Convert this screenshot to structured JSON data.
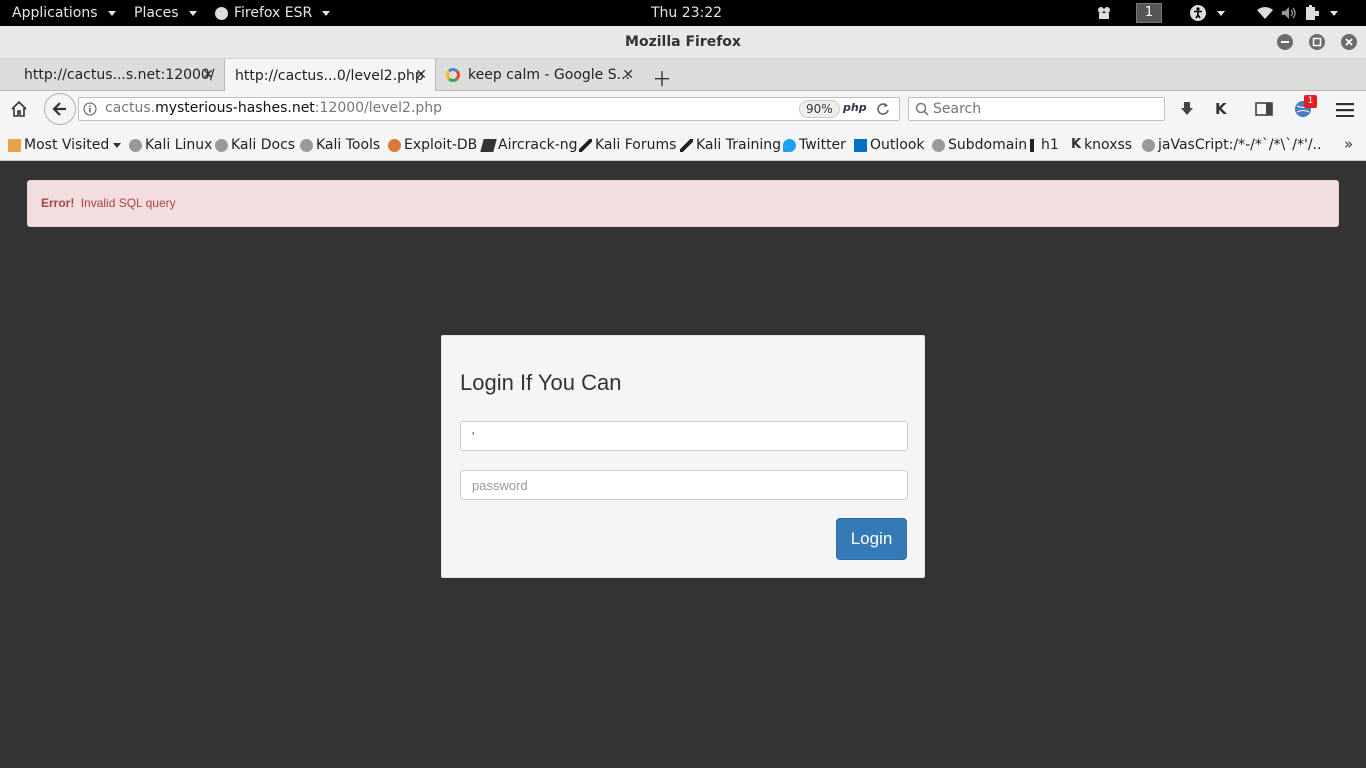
{
  "topbar": {
    "applications": "Applications",
    "places": "Places",
    "firefox_esr": "Firefox ESR",
    "clock": "Thu 23:22",
    "workspace": "1"
  },
  "window": {
    "title": "Mozilla Firefox"
  },
  "tabs": [
    {
      "label": "http://cactus...s.net:12000/"
    },
    {
      "label": "http://cactus...0/level2.php"
    },
    {
      "label": "keep calm - Google S..."
    }
  ],
  "navbar": {
    "url_host_prefix": "cactus.",
    "url_domain": "mysterious-hashes.net",
    "url_path": ":12000/level2.php",
    "zoom": "90%",
    "search_placeholder": "Search",
    "notification_count": "1"
  },
  "bookmarks": [
    {
      "label": "Most Visited"
    },
    {
      "label": "Kali Linux"
    },
    {
      "label": "Kali Docs"
    },
    {
      "label": "Kali Tools"
    },
    {
      "label": "Exploit-DB"
    },
    {
      "label": "Aircrack-ng"
    },
    {
      "label": "Kali Forums"
    },
    {
      "label": "Kali Training"
    },
    {
      "label": "Twitter"
    },
    {
      "label": "Outlook"
    },
    {
      "label": "Subdomain"
    },
    {
      "label": "h1"
    },
    {
      "label": "knoxss"
    },
    {
      "label": "jaVasCript:/*-/*`/*\\`/*'/..."
    }
  ],
  "page": {
    "alert_strong": "Error!",
    "alert_text": "Invalid SQL query",
    "form_title": "Login If You Can",
    "username_value": "'",
    "password_placeholder": "password",
    "login_button": "Login"
  },
  "colors": {
    "page_background": "#333333",
    "alert_background": "#f2dede",
    "alert_text": "#a94442",
    "button_primary": "#337ab7"
  }
}
